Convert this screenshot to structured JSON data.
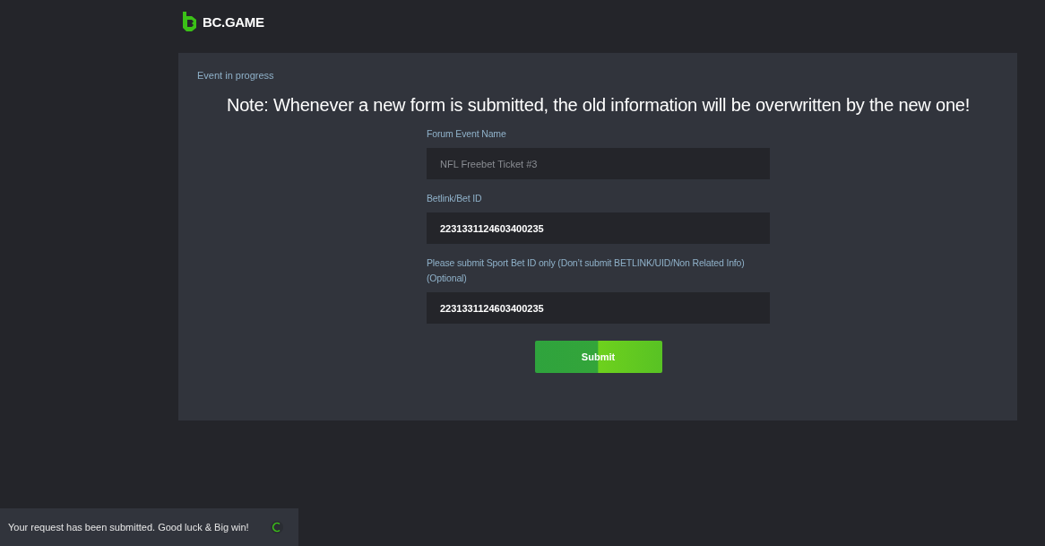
{
  "header": {
    "logo_text": "BC.GAME"
  },
  "card": {
    "status": "Event in progress",
    "note": "Note: Whenever a new form is submitted, the old information will be overwritten by the new one!"
  },
  "fields": [
    {
      "label": "Forum Event Name",
      "value": "NFL Freebet Ticket #3",
      "disabled": true
    },
    {
      "label": "Betlink/Bet ID",
      "value": "2231331124603400235",
      "disabled": false
    },
    {
      "label": "Please submit Sport Bet ID only (Don’t submit BETLINK/UID/Non Related Info) (Optional)",
      "value": "2231331124603400235",
      "disabled": false
    }
  ],
  "submit_button": "Submit",
  "toast": {
    "message": "Your request has been submitted. Good luck & Big win!"
  }
}
